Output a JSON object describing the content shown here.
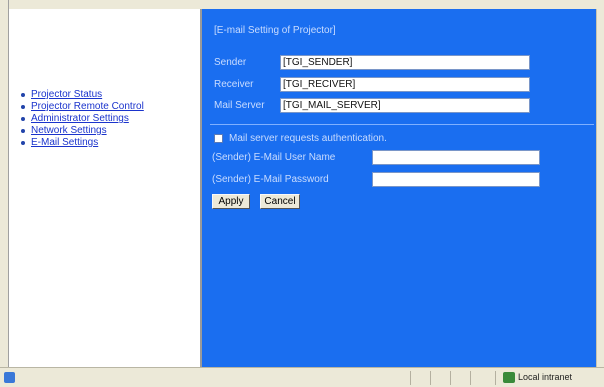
{
  "nav": {
    "items": [
      {
        "label": "Projector Status"
      },
      {
        "label": "Projector Remote Control"
      },
      {
        "label": "Administrator Settings"
      },
      {
        "label": "Network Settings"
      },
      {
        "label": "E-Mail Settings"
      }
    ]
  },
  "content": {
    "title": "[E-mail Setting of Projector]",
    "sender_label": "Sender",
    "sender_value": "[TGI_SENDER]",
    "receiver_label": "Receiver",
    "receiver_value": "[TGI_RECIVER]",
    "mail_server_label": "Mail Server",
    "mail_server_value": "[TGI_MAIL_SERVER]",
    "auth_label": "Mail server requests authentication.",
    "username_label": "(Sender) E-Mail User Name",
    "username_value": "",
    "password_label": "(Sender) E-Mail Password",
    "password_value": "",
    "apply_label": "Apply",
    "cancel_label": "Cancel"
  },
  "statusbar": {
    "zone": "Local intranet",
    "status_icon": "ie-page-icon",
    "zone_icon": "local-intranet-icon"
  },
  "colors": {
    "content_bg": "#1a6ef0",
    "nav_bg": "#ffffff",
    "link": "#1a33cc"
  }
}
